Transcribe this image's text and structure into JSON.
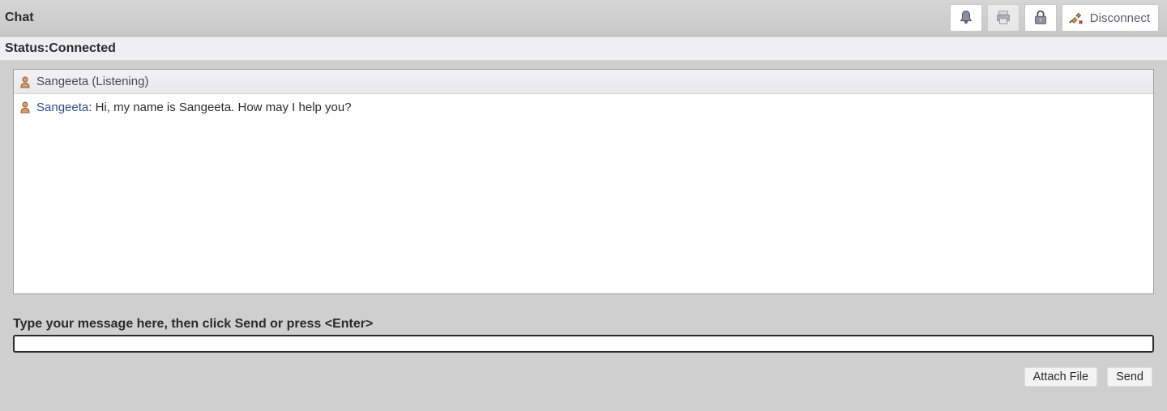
{
  "header": {
    "title": "Chat",
    "disconnect_label": "Disconnect"
  },
  "status": {
    "prefix": "Status: ",
    "value": "Connected"
  },
  "banner": {
    "agent_name": "Sangeeta",
    "state_suffix": " (Listening)"
  },
  "message": {
    "sender": "Sangeeta",
    "separator": ": ",
    "body": "Hi, my name is Sangeeta. How may I help you?"
  },
  "input": {
    "label": "Type your message here, then click Send or press <Enter>",
    "value": ""
  },
  "actions": {
    "attach": "Attach File",
    "send": "Send"
  }
}
